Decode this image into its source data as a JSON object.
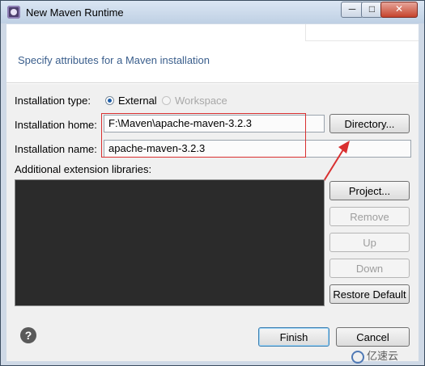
{
  "window": {
    "title": "New Maven Runtime",
    "min": "─",
    "max": "□",
    "close": "✕"
  },
  "banner": {
    "message": "Specify attributes for a Maven installation"
  },
  "form": {
    "installation_type_label": "Installation type:",
    "type_external": "External",
    "type_workspace": "Workspace",
    "home_label": "Installation home:",
    "home_value": "F:\\Maven\\apache-maven-3.2.3",
    "name_label": "Installation name:",
    "name_value": "apache-maven-3.2.3",
    "libs_label": "Additional extension libraries:"
  },
  "buttons": {
    "directory": "Directory...",
    "project": "Project...",
    "remove": "Remove",
    "up": "Up",
    "down": "Down",
    "restore": "Restore Default",
    "finish": "Finish",
    "cancel": "Cancel",
    "help": "?"
  },
  "watermark": {
    "text": "亿速云"
  },
  "colors": {
    "annotation": "#d93030",
    "banner_text": "#3a5e8c"
  }
}
